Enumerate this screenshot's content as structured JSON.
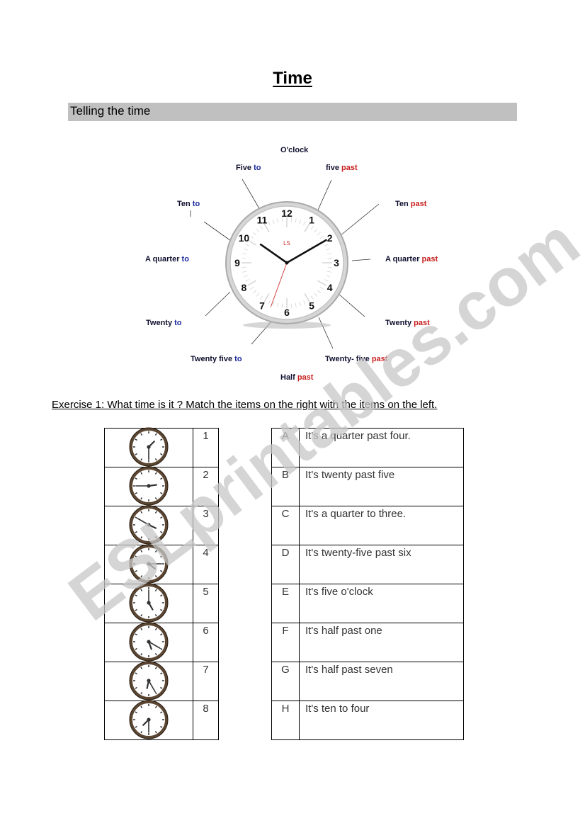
{
  "document": {
    "title": "Time",
    "section_heading": "Telling the time"
  },
  "clock_diagram": {
    "brand_mark": "LS",
    "numerals": [
      "12",
      "1",
      "2",
      "3",
      "4",
      "5",
      "6",
      "7",
      "8",
      "9",
      "10",
      "11"
    ],
    "displayed_time": "10:10",
    "labels": [
      {
        "id": "oclock",
        "main": "O'clock",
        "suffix": ""
      },
      {
        "id": "five-past",
        "main": "five ",
        "suffix": "past",
        "suffix_type": "past"
      },
      {
        "id": "ten-past",
        "main": "Ten ",
        "suffix": "past",
        "suffix_type": "past"
      },
      {
        "id": "quarter-past",
        "main": "A quarter ",
        "suffix": "past",
        "suffix_type": "past"
      },
      {
        "id": "twenty-past",
        "main": "Twenty ",
        "suffix": "past",
        "suffix_type": "past"
      },
      {
        "id": "twenty-five-past",
        "main": "Twenty- five ",
        "suffix": "past",
        "suffix_type": "past"
      },
      {
        "id": "half-past",
        "main": "Half ",
        "suffix": "past",
        "suffix_type": "past"
      },
      {
        "id": "twenty-five-to",
        "main": "Twenty five ",
        "suffix": "to",
        "suffix_type": "to"
      },
      {
        "id": "twenty-to",
        "main": "Twenty ",
        "suffix": "to",
        "suffix_type": "to"
      },
      {
        "id": "quarter-to",
        "main": "A quarter ",
        "suffix": "to",
        "suffix_type": "to"
      },
      {
        "id": "ten-to",
        "main": "Ten ",
        "suffix": "to",
        "suffix_type": "to"
      },
      {
        "id": "five-to",
        "main": "Five ",
        "suffix": "to",
        "suffix_type": "to"
      }
    ]
  },
  "exercise": {
    "instruction": "Exercise 1: What time is it ?  Match the items on the right with the items on the left.",
    "clocks": [
      {
        "number": "1",
        "hour": 1,
        "minute": 30
      },
      {
        "number": "2",
        "hour": 2,
        "minute": 45
      },
      {
        "number": "3",
        "hour": 3,
        "minute": 50
      },
      {
        "number": "4",
        "hour": 4,
        "minute": 15
      },
      {
        "number": "5",
        "hour": 5,
        "minute": 0
      },
      {
        "number": "6",
        "hour": 5,
        "minute": 20
      },
      {
        "number": "7",
        "hour": 6,
        "minute": 25
      },
      {
        "number": "8",
        "hour": 7,
        "minute": 30
      }
    ],
    "answers": [
      {
        "letter": "A",
        "text": "It's a quarter past four."
      },
      {
        "letter": "B",
        "text": "It's twenty past five"
      },
      {
        "letter": "C",
        "text": "It's a quarter to three."
      },
      {
        "letter": "D",
        "text": "It's twenty-five past six"
      },
      {
        "letter": "E",
        "text": "It's five o'clock"
      },
      {
        "letter": "F",
        "text": "It's half past one"
      },
      {
        "letter": "G",
        "text": "It's half past seven"
      },
      {
        "letter": "H",
        "text": "It's ten to four"
      }
    ]
  },
  "watermark": {
    "text": "ESLprintables.com",
    "color": "#c8c8c8"
  },
  "colors": {
    "to": "#1c2a9c",
    "past": "#c82020",
    "section_bar": "#c0c0c0",
    "clock_rim": "#5a4632"
  }
}
